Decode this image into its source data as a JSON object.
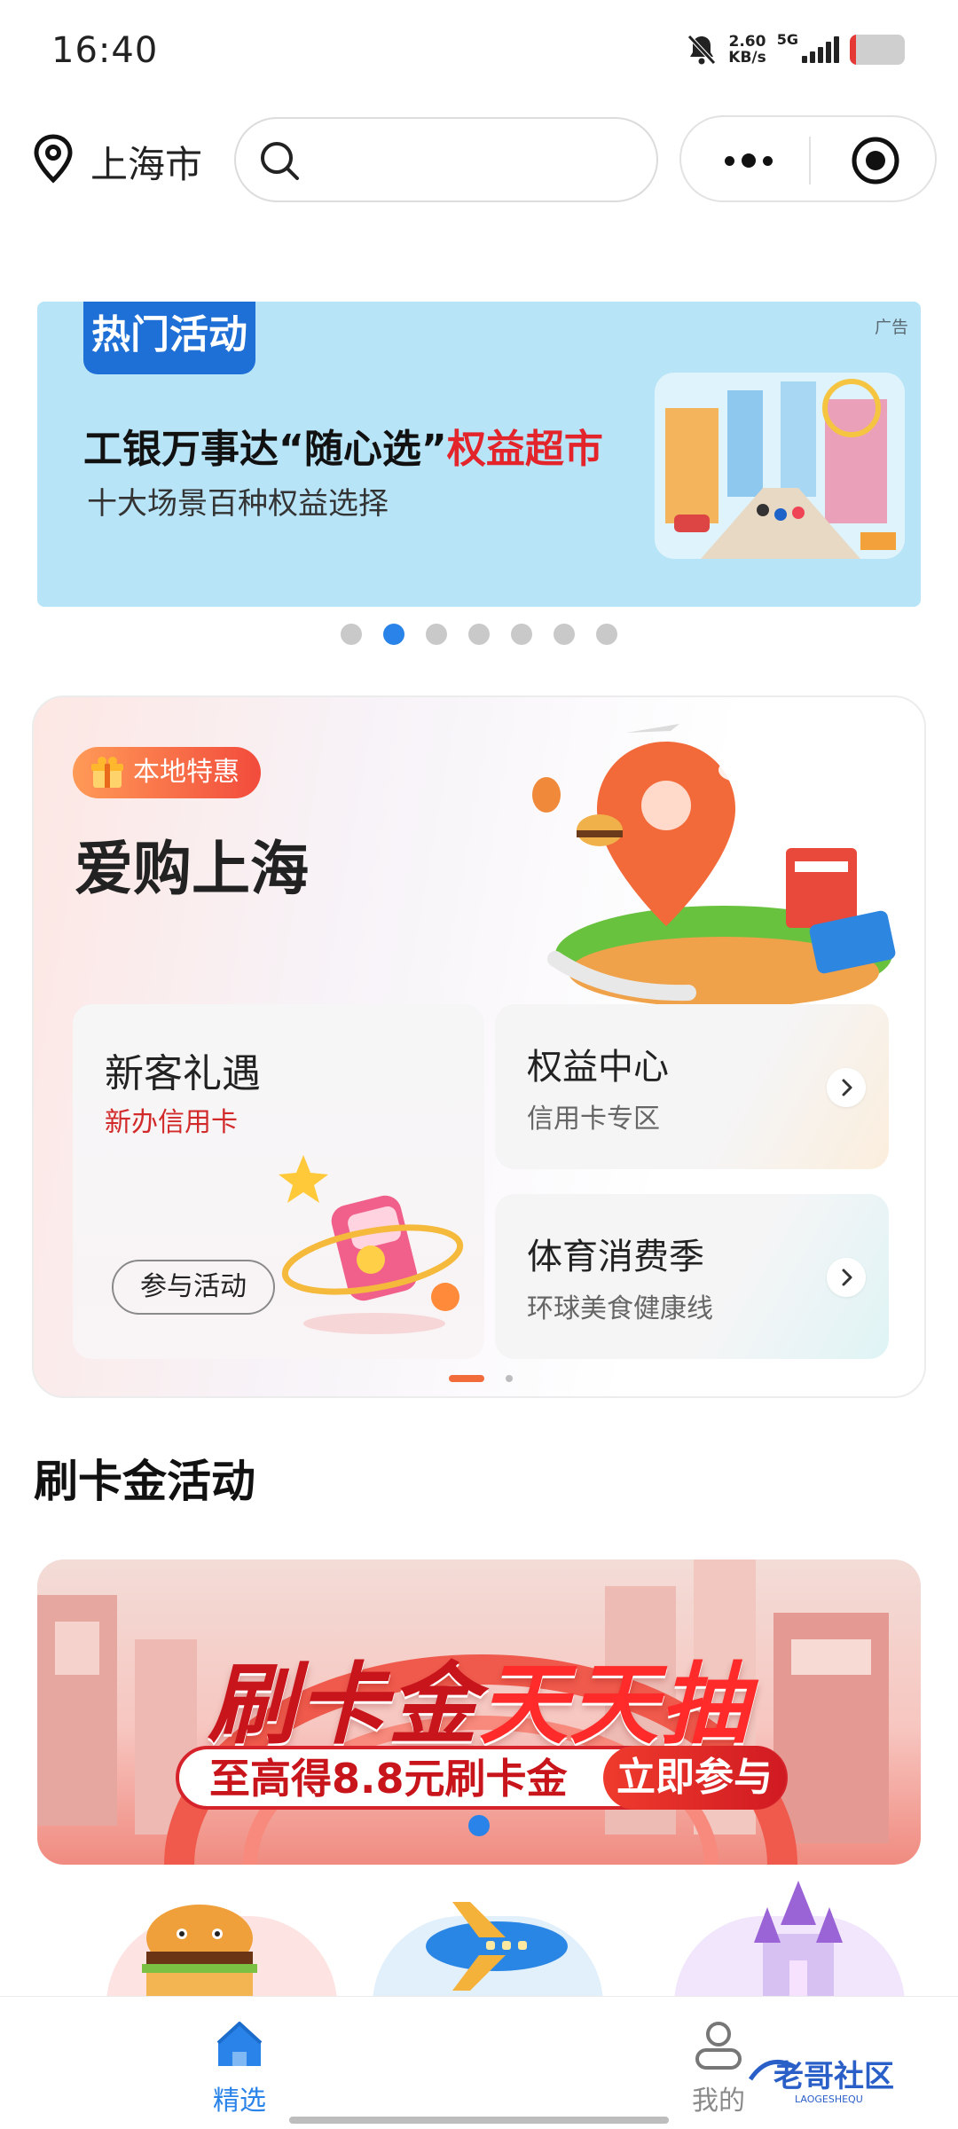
{
  "status_bar": {
    "time": "16:40",
    "net_speed_value": "2.60",
    "net_speed_unit": "KB/s",
    "network": "5G",
    "icons": [
      "mute-bell-icon",
      "signal-icon",
      "battery-icon"
    ],
    "battery_level": 0.12
  },
  "top_bar": {
    "city": "上海市",
    "search_placeholder": "",
    "icons": [
      "location-pin-icon",
      "search-icon",
      "more-icon",
      "target-icon"
    ]
  },
  "banner": {
    "tag": "热门活动",
    "ad_label": "广告",
    "title_black": "工银万事达“随心选”",
    "title_red": "权益超市",
    "subtitle": "十大场景百种权益选择",
    "page_count": 7,
    "active_page": 2,
    "accent": "#2a83e8"
  },
  "local_card": {
    "tag": "本地特惠",
    "title": "爱购上海",
    "left_tile": {
      "title": "新客礼遇",
      "subtitle": "新办信用卡",
      "button": "参与活动"
    },
    "right_tiles": [
      {
        "title": "权益中心",
        "subtitle": "信用卡专区"
      },
      {
        "title": "体育消费季",
        "subtitle": "环球美食健康线"
      }
    ],
    "page_count": 2,
    "active_page": 1
  },
  "section": {
    "title": "刷卡金活动"
  },
  "promo": {
    "title_a": "刷卡金",
    "title_b": "天天抽",
    "pill_text": "至高得8.8元刷卡金",
    "cta": "立即参与"
  },
  "tabbar": {
    "items": [
      {
        "label": "精选",
        "active": true,
        "icon": "home-icon"
      },
      {
        "label": "我的",
        "active": false,
        "icon": "user-icon"
      }
    ],
    "watermark": "老哥社区",
    "watermark_sub": "LAOGESHEQU"
  },
  "colors": {
    "primary_blue": "#2a83e8",
    "promo_red": "#c8141b",
    "tag_orange": "#f24b3c"
  }
}
